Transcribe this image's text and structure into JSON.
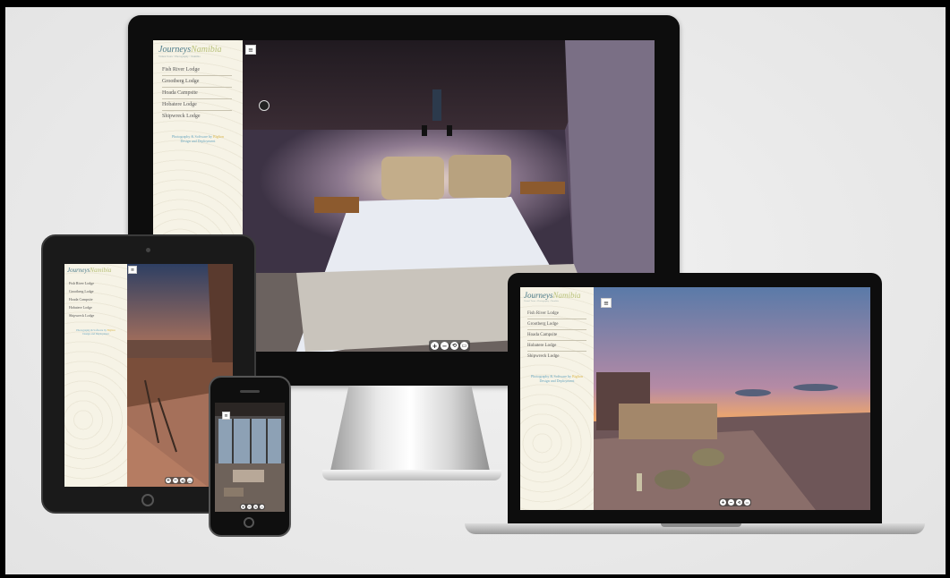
{
  "site": {
    "logo_main": "Journeys",
    "logo_accent": "Namibia",
    "logo_sub": "Virtual Tours • Photography • Namibia"
  },
  "menu": [
    {
      "label": "Fish River Lodge"
    },
    {
      "label": "Grootberg Lodge"
    },
    {
      "label": "Hoada Campsite"
    },
    {
      "label": "Hobatere Lodge"
    },
    {
      "label": "Shipwreck Lodge"
    }
  ],
  "credit": {
    "text": "Photography & Software by ",
    "brand": "Biglion",
    "line2": "Design and Deployment"
  },
  "burger_icon": "hamburger-menu-icon",
  "controls": {
    "zoom_in": "+",
    "zoom_out": "−",
    "rotate": "⟲",
    "fullscreen": "▭"
  },
  "colors": {
    "sidebar_bg": "#f6f3e6",
    "logo_blue": "#4d7c8a",
    "logo_green": "#b9c27a",
    "credit_blue": "#6aa7c0"
  }
}
